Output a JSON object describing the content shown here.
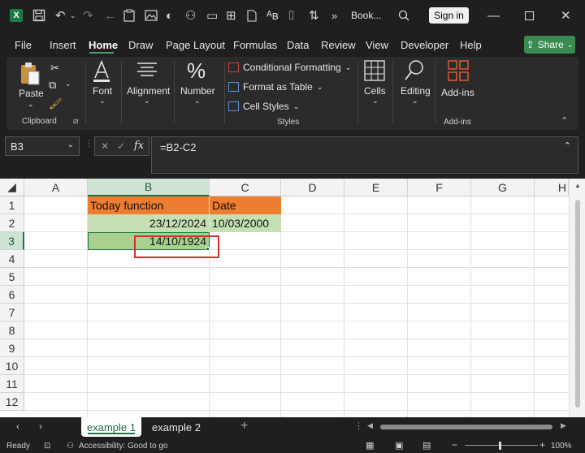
{
  "titlebar": {
    "app_icon": "excel-logo-icon",
    "doc_title": "Book...",
    "sign_in_label": "Sign in",
    "overflow_label": "»"
  },
  "menu": {
    "items": [
      "File",
      "Insert",
      "Home",
      "Draw",
      "Page Layout",
      "Formulas",
      "Data",
      "Review",
      "View",
      "Developer",
      "Help"
    ],
    "active": "Home",
    "share_label": "Share"
  },
  "ribbon": {
    "clipboard": {
      "paste_label": "Paste",
      "group_label": "Clipboard"
    },
    "font_label": "Font",
    "alignment_label": "Alignment",
    "number_label": "Number",
    "styles": {
      "conditional_formatting": "Conditional Formatting",
      "format_as_table": "Format as Table",
      "cell_styles": "Cell Styles",
      "group_label": "Styles"
    },
    "cells_label": "Cells",
    "editing_label": "Editing",
    "addins": {
      "button_label": "Add-ins",
      "group_label": "Add-ins"
    }
  },
  "formula_bar": {
    "name_box": "B3",
    "fx_label": "fx",
    "formula": "=B2-C2"
  },
  "grid": {
    "columns": [
      "A",
      "B",
      "C",
      "D",
      "E",
      "F",
      "G",
      "H"
    ],
    "rows": [
      "1",
      "2",
      "3",
      "4",
      "5",
      "6",
      "7",
      "8",
      "9",
      "10",
      "11",
      "12"
    ],
    "selected_cell": "B3",
    "cells": {
      "B1": "Today function",
      "C1": "Date",
      "B2": "23/12/2024",
      "C2": "10/03/2000",
      "B3": "14/10/1924"
    },
    "colors": {
      "header_fill": "#ed7d31",
      "data_fill": "#c6e0b4",
      "selected_fill": "#a9d08e",
      "highlight_box": "#d32f2f"
    }
  },
  "sheets": {
    "tabs": [
      "example 1",
      "example 2"
    ],
    "active": "example 1",
    "add_label": "+"
  },
  "status": {
    "ready": "Ready",
    "accessibility": "Accessibility: Good to go",
    "zoom": "100%"
  }
}
